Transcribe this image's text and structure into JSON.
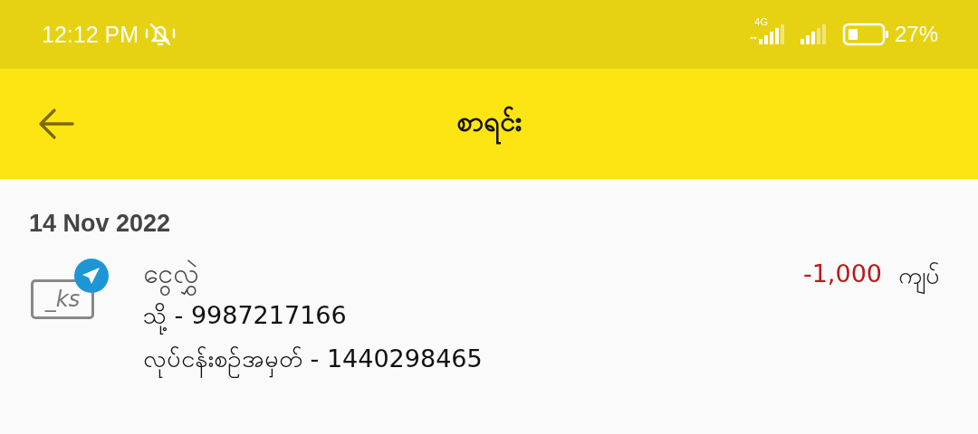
{
  "status_bar": {
    "time": "12:12 PM",
    "network": "4G",
    "battery": "27%"
  },
  "app_bar": {
    "title": "စာရင်း"
  },
  "groups": [
    {
      "date": "14 Nov 2022",
      "transactions": [
        {
          "logo_text": "_ks",
          "title": "ငွေလွှဲ",
          "lines": [
            "သို့ - 9987217166",
            "လုပ်ငန်းစဉ်အမှတ် - 1440298465"
          ],
          "amount": "-1,000",
          "kind": "debit",
          "currency": "ကျပ်"
        }
      ]
    }
  ]
}
